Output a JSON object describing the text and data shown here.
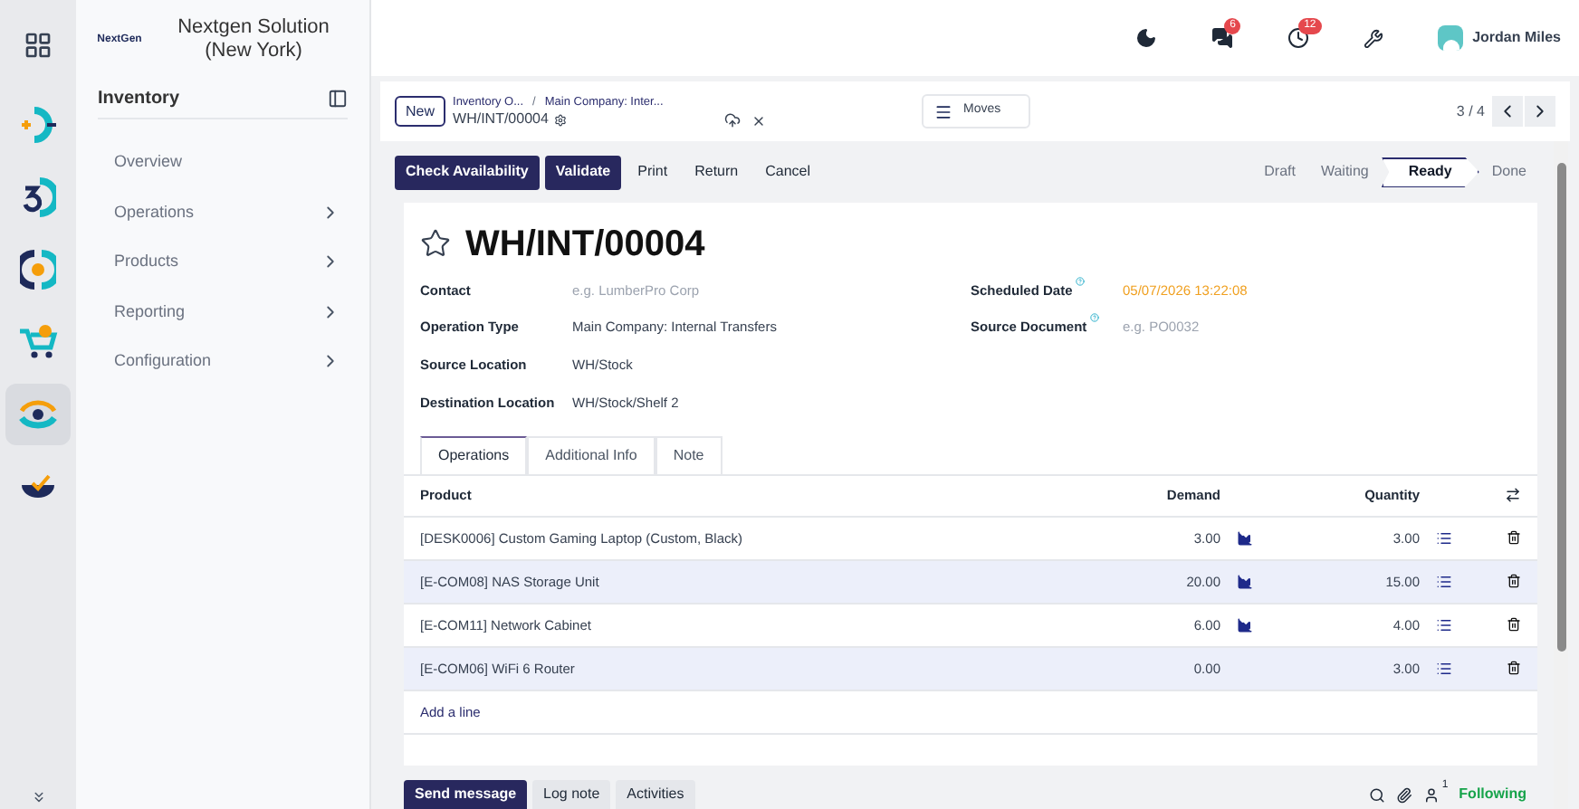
{
  "rail": [
    {
      "kind": "grid",
      "selected": false
    },
    {
      "kind": "plusminus",
      "selected": false
    },
    {
      "kind": "three",
      "selected": false
    },
    {
      "kind": "coin",
      "selected": false
    },
    {
      "kind": "cart",
      "selected": false
    },
    {
      "kind": "eye",
      "selected": true
    },
    {
      "kind": "bowl",
      "selected": false
    }
  ],
  "company": {
    "logo_text": "NextGen",
    "name": "Nextgen Solution (New York)"
  },
  "sidebar": {
    "title": "Inventory",
    "items": [
      {
        "label": "Overview",
        "expandable": false
      },
      {
        "label": "Operations",
        "expandable": true
      },
      {
        "label": "Products",
        "expandable": true
      },
      {
        "label": "Reporting",
        "expandable": true
      },
      {
        "label": "Configuration",
        "expandable": true
      }
    ]
  },
  "topbar": {
    "messages_count": "6",
    "activities_count": "12",
    "user": "Jordan Miles"
  },
  "control_panel": {
    "new_button": "New",
    "breadcrumbs": [
      "Inventory O...",
      "Main Company: Inter..."
    ],
    "breadcrumb_separator": "/",
    "record": "WH/INT/00004",
    "moves_button": "Moves",
    "pager": "3 / 4"
  },
  "actions": [
    {
      "label": "Check Availability",
      "primary": true
    },
    {
      "label": "Validate",
      "primary": true
    },
    {
      "label": "Print",
      "primary": false
    },
    {
      "label": "Return",
      "primary": false
    },
    {
      "label": "Cancel",
      "primary": false
    }
  ],
  "stages": [
    {
      "label": "Draft",
      "selected": false
    },
    {
      "label": "Waiting",
      "selected": false
    },
    {
      "label": "Ready",
      "selected": true
    },
    {
      "label": "Done",
      "selected": false
    }
  ],
  "form": {
    "title": "WH/INT/00004",
    "starred": false,
    "left_fields": [
      {
        "label": "Contact",
        "placeholder": "e.g. LumberPro Corp",
        "help": false
      },
      {
        "label": "Operation Type",
        "value": "Main Company: Internal Transfers",
        "help": false
      },
      {
        "label": "Source Location",
        "value": "WH/Stock",
        "help": false
      },
      {
        "label": "Destination Location",
        "value": "WH/Stock/Shelf 2",
        "help": false
      }
    ],
    "right_fields": [
      {
        "label": "Scheduled Date",
        "value": "05/07/2026 13:22:08",
        "help": true,
        "warning": true
      },
      {
        "label": "Source Document",
        "placeholder": "e.g. PO0032",
        "help": true,
        "warning": false
      }
    ]
  },
  "tabs": [
    {
      "label": "Operations",
      "selected": true
    },
    {
      "label": "Additional Info",
      "selected": false
    },
    {
      "label": "Note",
      "selected": false
    }
  ],
  "table": {
    "columns": [
      "Product",
      "Demand",
      "Quantity"
    ],
    "rows": [
      {
        "product": "[DESK0006] Custom Gaming Laptop (Custom, Black)",
        "demand": "3.00",
        "forecast": true,
        "quantity": "3.00"
      },
      {
        "product": "[E-COM08] NAS Storage Unit",
        "demand": "20.00",
        "forecast": true,
        "quantity": "15.00"
      },
      {
        "product": "[E-COM11] Network Cabinet",
        "demand": "6.00",
        "forecast": true,
        "quantity": "4.00"
      },
      {
        "product": "[E-COM06] WiFi 6 Router",
        "demand": "0.00",
        "forecast": false,
        "quantity": "3.00"
      }
    ],
    "add_line": "Add a line"
  },
  "chatter": {
    "buttons": [
      {
        "label": "Send message",
        "selected": true
      },
      {
        "label": "Log note",
        "selected": false
      },
      {
        "label": "Activities",
        "selected": false
      }
    ],
    "followers": "1",
    "following": "Following"
  }
}
